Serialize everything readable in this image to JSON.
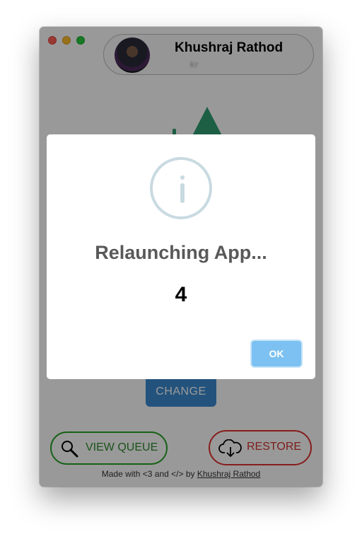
{
  "window": {
    "traffic_lights": [
      "close",
      "minimize",
      "maximize"
    ],
    "profile": {
      "name": "Khushraj Rathod",
      "subtitle": "kr"
    },
    "main": {
      "change_label": "CHANGE"
    },
    "actions": {
      "view_queue_label": "VIEW QUEUE",
      "restore_label": "RESTORE"
    },
    "footer": {
      "prefix": "Made with <3 and </> by ",
      "author_link": "Khushraj Rathod"
    }
  },
  "dialog": {
    "icon": "info-icon",
    "title": "Relaunching App...",
    "countdown": "4",
    "ok_label": "OK"
  },
  "colors": {
    "accent_blue": "#3b8bd1",
    "ok_blue": "#7cc1f1",
    "queue_green": "#27a327",
    "restore_red": "#e0322f",
    "logo_green": "#2f9e72"
  }
}
